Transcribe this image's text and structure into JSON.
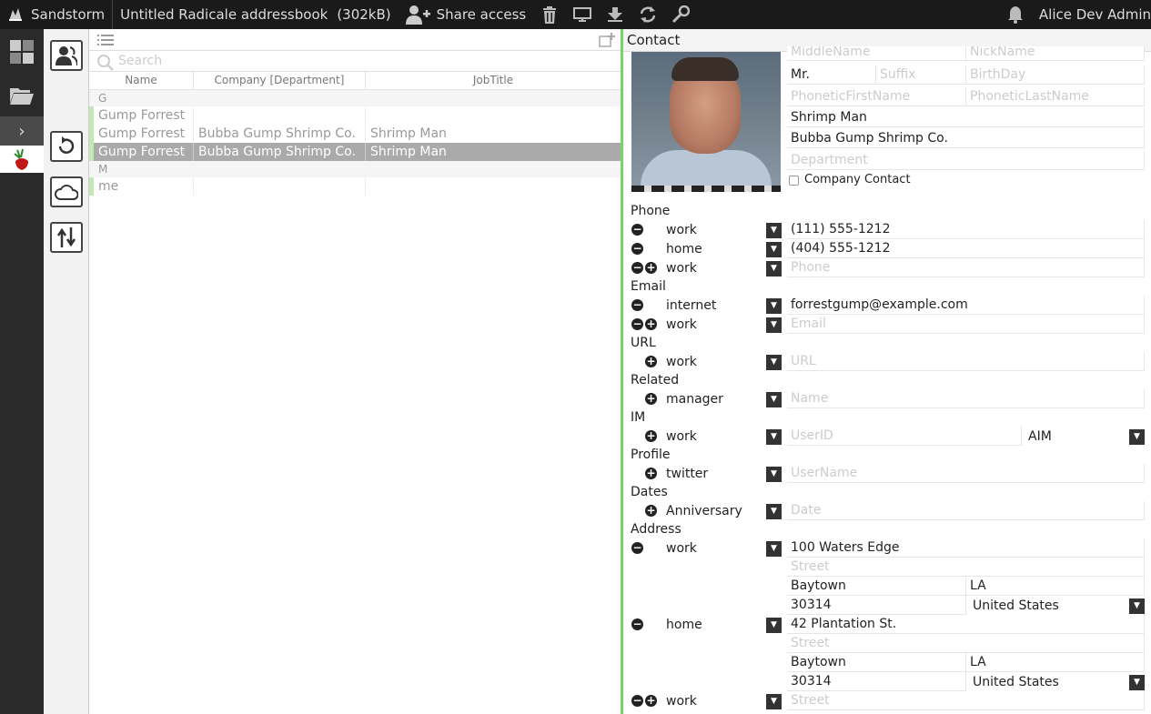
{
  "topbar": {
    "brand": "Sandstorm",
    "doc_title": "Untitled Radicale addressbook",
    "doc_size": "(302kB)",
    "share_label": "Share access",
    "user_name": "Alice Dev Admin"
  },
  "list": {
    "search_placeholder": "Search",
    "columns": [
      "Name",
      "Company [Department]",
      "JobTitle"
    ],
    "group_g": "G",
    "group_m": "M",
    "rows": [
      {
        "name": "Gump Forrest",
        "company": "",
        "job": ""
      },
      {
        "name": "Gump Forrest",
        "company": "Bubba Gump Shrimp Co.",
        "job": "Shrimp Man"
      },
      {
        "name": "Gump Forrest",
        "company": "Bubba Gump Shrimp Co.",
        "job": "Shrimp Man"
      },
      {
        "name": "me",
        "company": "",
        "job": ""
      }
    ]
  },
  "contact": {
    "title": "Contact",
    "middle_name_ph": "MiddleName",
    "nick_name_ph": "NickName",
    "prefix": "Mr.",
    "suffix_ph": "Suffix",
    "birthday_ph": "BirthDay",
    "phonetic_first_ph": "PhoneticFirstName",
    "phonetic_last_ph": "PhoneticLastName",
    "job_title": "Shrimp Man",
    "company": "Bubba Gump Shrimp Co.",
    "department_ph": "Department",
    "company_contact_label": "Company Contact",
    "sections": {
      "phone": "Phone",
      "email": "Email",
      "url": "URL",
      "related": "Related",
      "im": "IM",
      "profile": "Profile",
      "dates": "Dates",
      "address": "Address"
    },
    "phones": [
      {
        "type": "work",
        "value": "(111) 555-1212"
      },
      {
        "type": "home",
        "value": "(404) 555-1212"
      },
      {
        "type": "work",
        "placeholder": "Phone"
      }
    ],
    "emails": [
      {
        "type": "internet",
        "value": "forrestgump@example.com"
      },
      {
        "type": "work",
        "placeholder": "Email"
      }
    ],
    "url": {
      "type": "work",
      "placeholder": "URL"
    },
    "related": {
      "type": "manager",
      "placeholder": "Name"
    },
    "im": {
      "type": "work",
      "placeholder": "UserID",
      "service": "AIM"
    },
    "profile": {
      "type": "twitter",
      "placeholder": "UserName"
    },
    "date": {
      "type": "Anniversary",
      "placeholder": "Date"
    },
    "street_ph": "Street",
    "addresses": [
      {
        "type": "work",
        "street": "100 Waters Edge",
        "city": "Baytown",
        "state": "LA",
        "zip": "30314",
        "country": "United States"
      },
      {
        "type": "home",
        "street": "42 Plantation St.",
        "city": "Baytown",
        "state": "LA",
        "zip": "30314",
        "country": "United States"
      },
      {
        "type": "work"
      }
    ]
  }
}
